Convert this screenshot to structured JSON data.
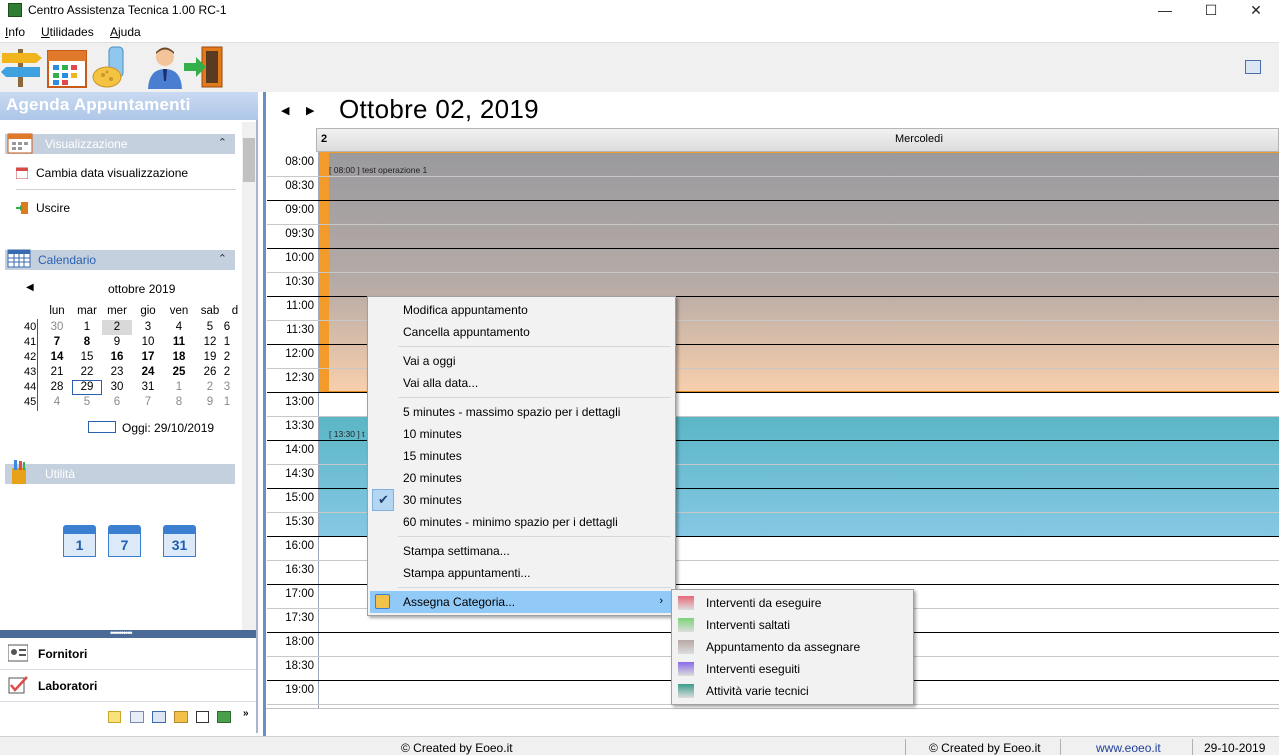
{
  "window": {
    "title": "Centro Assistenza Tecnica 1.00 RC-1"
  },
  "menubar": [
    {
      "label": "Info",
      "ul": "I",
      "rest": "nfo"
    },
    {
      "label": "Utilidades",
      "ul": "U",
      "rest": "tilidades"
    },
    {
      "label": "Ajuda",
      "ul": "A",
      "rest": "juda"
    }
  ],
  "toolbar": {
    "icons": [
      "signpost-icon",
      "calendar-icon",
      "sponge-bottle-icon",
      "user-icon",
      "exit-door-icon"
    ]
  },
  "leftpane": {
    "header": "Agenda Appuntamenti",
    "visualizzazione": {
      "title": "Visualizzazione",
      "items": [
        "Cambia data visualizzazione",
        "Uscire"
      ]
    },
    "calendario": {
      "title": "Calendario",
      "month_label": "ottobre 2019",
      "weekdays": [
        "lun",
        "mar",
        "mer",
        "gio",
        "ven",
        "sab",
        "d"
      ],
      "weeks": [
        {
          "wk": "40",
          "days": [
            "30",
            "1",
            "2",
            "3",
            "4",
            "5",
            "6"
          ]
        },
        {
          "wk": "41",
          "days": [
            "7",
            "8",
            "9",
            "10",
            "11",
            "12",
            "1"
          ]
        },
        {
          "wk": "42",
          "days": [
            "14",
            "15",
            "16",
            "17",
            "18",
            "19",
            "2"
          ]
        },
        {
          "wk": "43",
          "days": [
            "21",
            "22",
            "23",
            "24",
            "25",
            "26",
            "2"
          ]
        },
        {
          "wk": "44",
          "days": [
            "28",
            "29",
            "30",
            "31",
            "1",
            "2",
            "3"
          ]
        },
        {
          "wk": "45",
          "days": [
            "4",
            "5",
            "6",
            "7",
            "8",
            "9",
            "1"
          ]
        }
      ],
      "today_label": "Oggi: 29/10/2019"
    },
    "utilita": {
      "title": "Utilità",
      "quick_days": [
        "1",
        "7",
        "31"
      ]
    },
    "nav_buttons": [
      "Fornitori",
      "Laboratori"
    ]
  },
  "calendar": {
    "date_title": "Ottobre 02,  2019",
    "day_number": "2",
    "day_name": "Mercoledì",
    "times": [
      "08:00",
      "08:30",
      "09:00",
      "09:30",
      "10:00",
      "10:30",
      "11:00",
      "11:30",
      "12:00",
      "12:30",
      "13:00",
      "13:30",
      "14:00",
      "14:30",
      "15:00",
      "15:30",
      "16:00",
      "16:30",
      "17:00",
      "17:30",
      "18:00",
      "18:30",
      "19:00"
    ],
    "events": [
      {
        "label": "[ 08:00 ] test operazione 1",
        "color": "#f29b2b"
      },
      {
        "label": "[ 13:30 ] t",
        "color": "#5ab6c5"
      }
    ]
  },
  "context_menu": {
    "groups": [
      [
        "Modifica appuntamento",
        "Cancella appuntamento"
      ],
      [
        "Vai a oggi",
        "Vai alla data..."
      ],
      [
        "5 minutes - massimo spazio per i dettagli",
        "10 minutes",
        "15 minutes",
        "20 minutes",
        "30 minutes",
        "60 minutes - minimo spazio per i dettagli"
      ],
      [
        "Stampa settimana...",
        "Stampa appuntamenti..."
      ],
      [
        "Assegna Categoria..."
      ]
    ],
    "checked": "30 minutes"
  },
  "submenu": {
    "items": [
      {
        "label": "Interventi da eseguire",
        "color": "#e56a7a"
      },
      {
        "label": "Interventi saltati",
        "color": "#7bd37b"
      },
      {
        "label": "Appuntamento da assegnare",
        "color": "#b9a8a4"
      },
      {
        "label": "Interventi eseguiti",
        "color": "#8a6ae8"
      },
      {
        "label": "Attività varie tecnici",
        "color": "#3d9d8a"
      }
    ]
  },
  "statusbar": {
    "created1": "© Created by Eoeo.it",
    "created2": "© Created by Eoeo.it",
    "site": "www.eoeo.it",
    "date": "29-10-2019"
  }
}
